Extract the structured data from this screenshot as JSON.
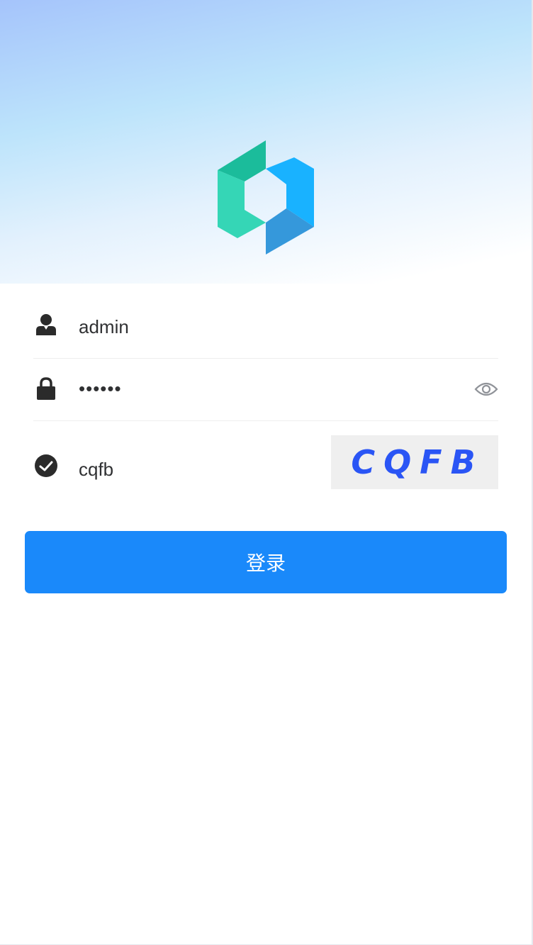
{
  "header": {
    "logo_icon": "hexagon-logo-icon",
    "gradient_colors": [
      "#a5c4fb",
      "#bde4fb",
      "#ffffff"
    ]
  },
  "form": {
    "username": {
      "icon": "user-icon",
      "value": "admin"
    },
    "password": {
      "icon": "lock-icon",
      "value": "••••••",
      "toggle_icon": "eye-icon"
    },
    "captcha": {
      "icon": "check-circle-icon",
      "value": "cqfb",
      "image_text": "CQFB"
    }
  },
  "login_button": {
    "label": "登录",
    "color": "#1a89fa"
  }
}
